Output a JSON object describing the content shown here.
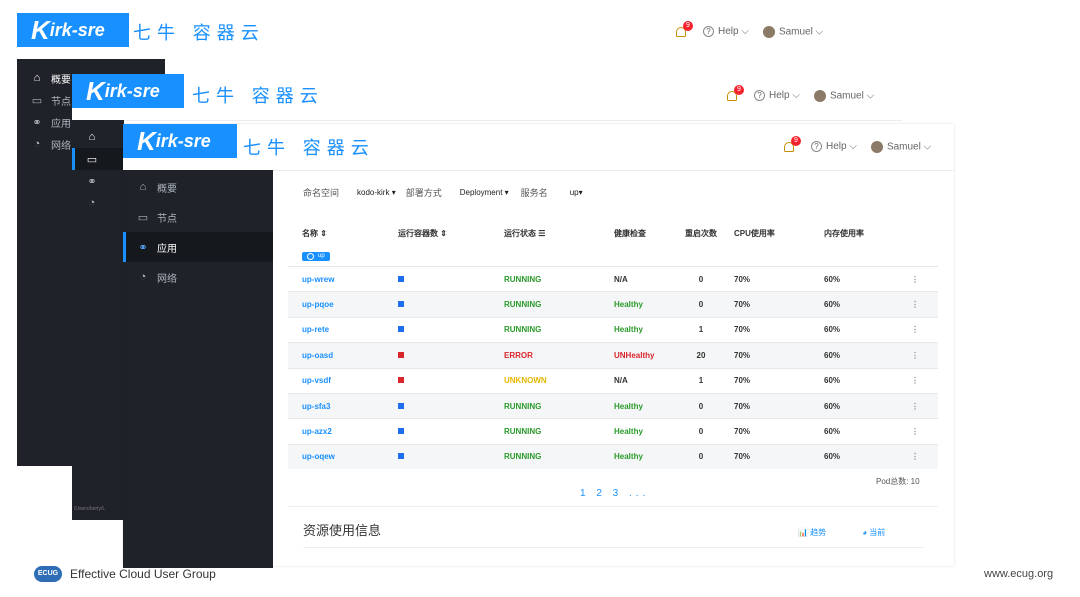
{
  "app": {
    "logo_k": "K",
    "logo_rest": "irk-sre",
    "brand": "七牛 容器云"
  },
  "topbar": {
    "notification_count": "9",
    "help": "Help ⌵",
    "user": "Samuel ⌵"
  },
  "sidebar_back": [
    "概要",
    "节点",
    "应用",
    "网络"
  ],
  "sidebar": {
    "items": [
      {
        "label": "概要",
        "icon": "⌂"
      },
      {
        "label": "节点",
        "icon": "▭"
      },
      {
        "label": "应用",
        "icon": "⚭"
      },
      {
        "label": "网络",
        "icon": "◔"
      }
    ],
    "active_index": 2
  },
  "filters": {
    "namespace_label": "命名空间",
    "namespace_value": "kodo-kirk ▾",
    "deploy_label": "部署方式",
    "deploy_value": "Deployment ▾",
    "service_label": "服务名",
    "service_value": "up▾"
  },
  "table": {
    "headers": [
      "名称 ⇕",
      "运行容器数 ⇕",
      "运行状态 ☰",
      "健康检查",
      "重启次数",
      "CPU使用率",
      "内存使用率",
      ""
    ],
    "toggle_label": "up",
    "rows": [
      {
        "name": "up-wrew",
        "color": "#1e6ff0",
        "status": "RUNNING",
        "status_color": "#2b9a2b",
        "health": "N/A",
        "health_color": "#333333",
        "restarts": "0",
        "cpu": "70%",
        "mem": "60%"
      },
      {
        "name": "up-pqoe",
        "color": "#1e6ff0",
        "status": "RUNNING",
        "status_color": "#2b9a2b",
        "health": "Healthy",
        "health_color": "#2b9a2b",
        "restarts": "0",
        "cpu": "70%",
        "mem": "60%"
      },
      {
        "name": "up-rete",
        "color": "#1e6ff0",
        "status": "RUNNING",
        "status_color": "#2b9a2b",
        "health": "Healthy",
        "health_color": "#2b9a2b",
        "restarts": "1",
        "cpu": "70%",
        "mem": "60%"
      },
      {
        "name": "up-oasd",
        "color": "#d9262c",
        "status": "ERROR",
        "status_color": "#d9262c",
        "health": "UNHealthy",
        "health_color": "#d9262c",
        "restarts": "20",
        "cpu": "70%",
        "mem": "60%"
      },
      {
        "name": "up-vsdf",
        "color": "#d9262c",
        "status": "UNKNOWN",
        "status_color": "#e6b800",
        "health": "N/A",
        "health_color": "#333333",
        "restarts": "1",
        "cpu": "70%",
        "mem": "60%"
      },
      {
        "name": "up-sfa3",
        "color": "#1e6ff0",
        "status": "RUNNING",
        "status_color": "#2b9a2b",
        "health": "Healthy",
        "health_color": "#2b9a2b",
        "restarts": "0",
        "cpu": "70%",
        "mem": "60%"
      },
      {
        "name": "up-azx2",
        "color": "#1e6ff0",
        "status": "RUNNING",
        "status_color": "#2b9a2b",
        "health": "Healthy",
        "health_color": "#2b9a2b",
        "restarts": "0",
        "cpu": "70%",
        "mem": "60%"
      },
      {
        "name": "up-oqew",
        "color": "#1e6ff0",
        "status": "RUNNING",
        "status_color": "#2b9a2b",
        "health": "Healthy",
        "health_color": "#2b9a2b",
        "restarts": "0",
        "cpu": "70%",
        "mem": "60%"
      }
    ]
  },
  "pagination": "1 2 3 ...",
  "pod_total": "Pod总数: 10",
  "resources": {
    "title": "资源使用信息",
    "trend": "📊 趋势",
    "current": "◕ 当前"
  },
  "path_text": "/Users/berty/L",
  "footer": {
    "badge": "ECUG",
    "left": "Effective Cloud User Group",
    "right": "www.ecug.org"
  }
}
